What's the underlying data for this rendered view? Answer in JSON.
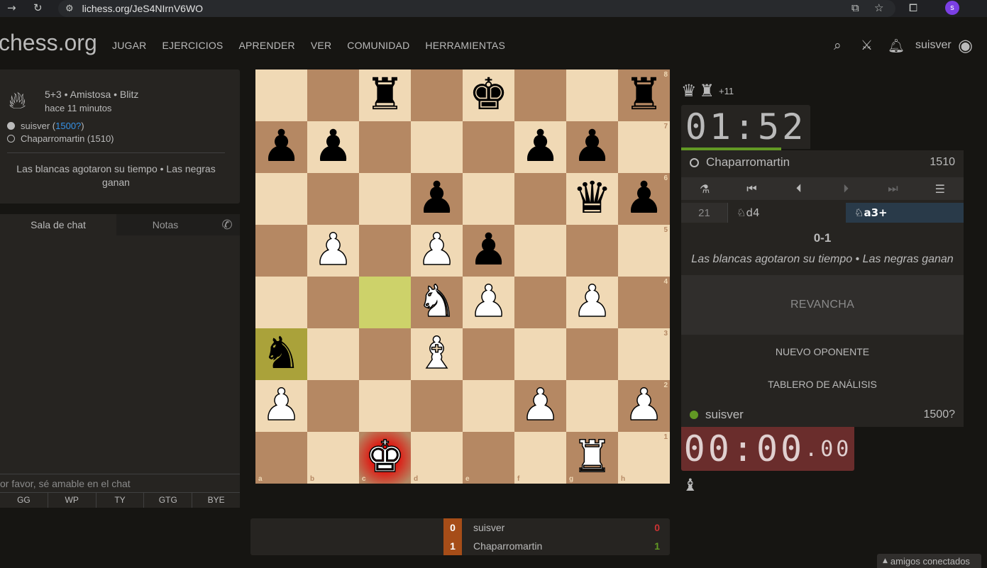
{
  "browser": {
    "url": "lichess.org/JeS4NIrnV6WO",
    "profile_initial": "s"
  },
  "header": {
    "logo": "chess.org",
    "nav": [
      "JUGAR",
      "EJERCICIOS",
      "APRENDER",
      "VER",
      "COMUNIDAD",
      "HERRAMIENTAS"
    ],
    "username": "suisver"
  },
  "game_info": {
    "settings": "5+3 • Amistosa • Blitz",
    "time_ago": "hace 11 minutos",
    "white_name": "suisver",
    "white_rating": "1500?",
    "black_player": "Chaparromartin (1510)",
    "result_text": "Las blancas agotaron su tiempo • Las negras ganan"
  },
  "chat": {
    "tab_chat": "Sala de chat",
    "tab_notes": "Notas",
    "placeholder": "or favor, sé amable en el chat",
    "quick_replies": [
      "GG",
      "WP",
      "TY",
      "GTG",
      "BYE"
    ]
  },
  "board": {
    "position": [
      [
        "",
        "",
        "r",
        "",
        "k",
        "",
        "",
        "r"
      ],
      [
        "p",
        "p",
        "",
        "",
        "",
        "p",
        "p",
        ""
      ],
      [
        "",
        "",
        "",
        "p",
        "",
        "",
        "q",
        "p"
      ],
      [
        "",
        "P",
        "",
        "P",
        "p",
        "",
        "",
        ""
      ],
      [
        "",
        "",
        "",
        "N",
        "P",
        "",
        "P",
        ""
      ],
      [
        "n",
        "",
        "",
        "B",
        "",
        "",
        "",
        ""
      ],
      [
        "P",
        "",
        "",
        "",
        "",
        "P",
        "",
        "P"
      ],
      [
        "",
        "",
        "K",
        "",
        "",
        "",
        "R",
        ""
      ]
    ],
    "files": [
      "a",
      "b",
      "c",
      "d",
      "e",
      "f",
      "g",
      "h"
    ],
    "ranks": [
      "8",
      "7",
      "6",
      "5",
      "4",
      "3",
      "2",
      "1"
    ],
    "last_move_squares": [
      "c4",
      "a3"
    ],
    "check_square": "c1"
  },
  "opponent": {
    "name": "Chaparromartin",
    "rating": "1510",
    "clock": "01:52",
    "material_diff": "+11",
    "material_icons": [
      "black-queen-icon",
      "black-rook-icon"
    ]
  },
  "player": {
    "name": "suisver",
    "rating": "1500?",
    "clock_main": "00:00",
    "clock_tenths": ".00",
    "material_icons": [
      "white-bishop-icon"
    ]
  },
  "moves": {
    "number": "21",
    "white": "♘d4",
    "black": "♘a3+"
  },
  "result": {
    "score": "0-1",
    "description": "Las blancas agotaron su tiempo • Las negras ganan"
  },
  "actions": {
    "rematch": "REVANCHA",
    "new_opponent": "NUEVO OPONENTE",
    "analysis": "TABLERO DE ANÁLISIS"
  },
  "crosstable": [
    {
      "score": "0",
      "name": "suisver",
      "result": "0"
    },
    {
      "score": "1",
      "name": "Chaparromartin",
      "result": "1"
    }
  ],
  "friends": "amigos conectados"
}
